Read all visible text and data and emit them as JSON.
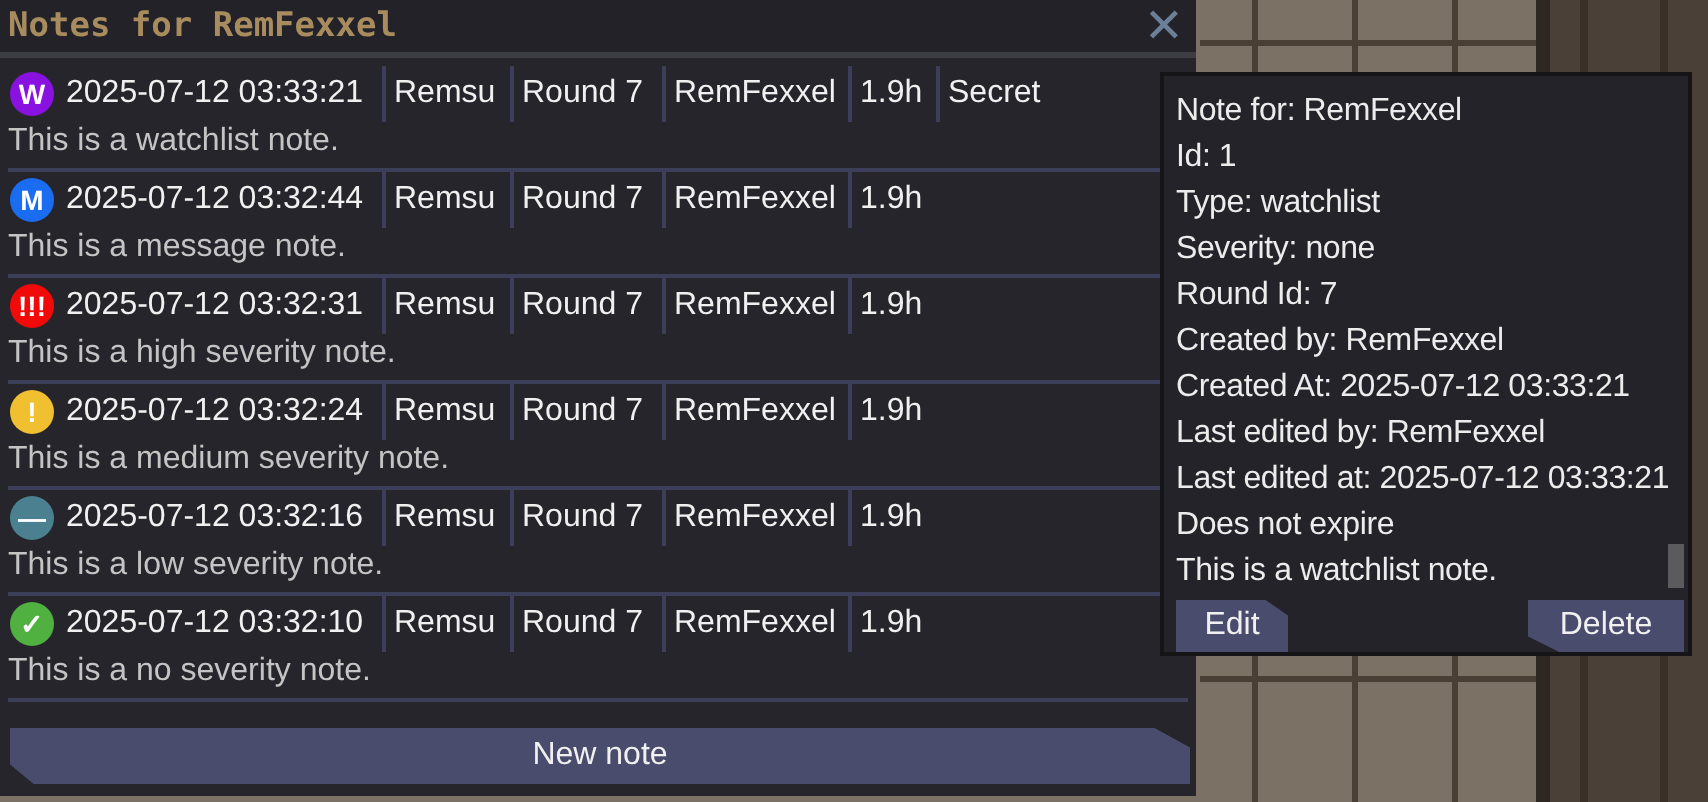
{
  "window": {
    "title": "Notes for RemFexxel",
    "close_label": "✕"
  },
  "notes": [
    {
      "badge": "W",
      "color": "#8a12e0",
      "time": "2025-07-12 03:33:21",
      "author": "Remsu",
      "round": "Round 7",
      "target": "RemFexxel",
      "duration": "1.9h",
      "secret": "Secret",
      "text": "This is a watchlist note."
    },
    {
      "badge": "M",
      "color": "#1a6cf0",
      "time": "2025-07-12 03:32:44",
      "author": "Remsu",
      "round": "Round 7",
      "target": "RemFexxel",
      "duration": "1.9h",
      "text": "This is a message note."
    },
    {
      "badge": "!!!",
      "color": "#f00a0a",
      "time": "2025-07-12 03:32:31",
      "author": "Remsu",
      "round": "Round 7",
      "target": "RemFexxel",
      "duration": "1.9h",
      "text": "This is a high severity note."
    },
    {
      "badge": "!",
      "color": "#f0c030",
      "time": "2025-07-12 03:32:24",
      "author": "Remsu",
      "round": "Round 7",
      "target": "RemFexxel",
      "duration": "1.9h",
      "text": "This is a medium severity note."
    },
    {
      "badge": "—",
      "color": "#4a8090",
      "time": "2025-07-12 03:32:16",
      "author": "Remsu",
      "round": "Round 7",
      "target": "RemFexxel",
      "duration": "1.9h",
      "text": "This is a low severity note."
    },
    {
      "badge": "✓",
      "color": "#50b040",
      "time": "2025-07-12 03:32:10",
      "author": "Remsu",
      "round": "Round 7",
      "target": "RemFexxel",
      "duration": "1.9h",
      "text": "This is a no severity note."
    }
  ],
  "new_note_button": "New note",
  "tooltip": {
    "lines": [
      "Note for: RemFexxel",
      "Id: 1",
      "Type: watchlist",
      "Severity: none",
      "Round Id: 7",
      "Created by: RemFexxel",
      "Created At: 2025-07-12 03:33:21",
      "Last edited by: RemFexxel",
      "Last edited at: 2025-07-12 03:33:21",
      "Does not expire",
      "This is a watchlist note."
    ],
    "buttons": [
      "Edit",
      "Delete"
    ]
  }
}
